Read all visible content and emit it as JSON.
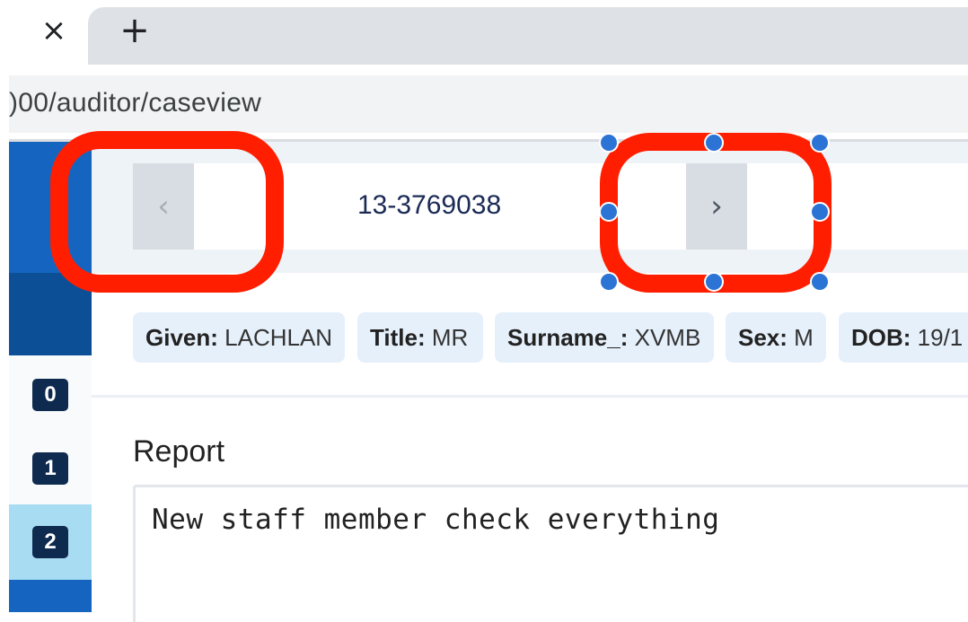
{
  "browser": {
    "close_tab_glyph": "×",
    "new_tab_glyph": "+",
    "url": ")00/auditor/caseview"
  },
  "sidebar": {
    "items": [
      {
        "label": "0"
      },
      {
        "label": "1"
      },
      {
        "label": "2"
      }
    ]
  },
  "case_nav": {
    "prev_glyph": "‹",
    "next_glyph": "›",
    "case_id": "13-3769038"
  },
  "patient": {
    "chips": [
      {
        "key": "Given:",
        "value": " LACHLAN"
      },
      {
        "key": "Title:",
        "value": " MR"
      },
      {
        "key": "Surname_:",
        "value": " XVMB"
      },
      {
        "key": "Sex:",
        "value": " M"
      },
      {
        "key": "DOB:",
        "value": " 19/1"
      }
    ]
  },
  "report": {
    "title": "Report",
    "text": "New staff member check everything"
  },
  "colors": {
    "annotation": "#ff1e00",
    "handle": "#2b74d6",
    "sidebar_primary": "#1565c0",
    "sidebar_highlight": "#a7dcf2"
  },
  "icons": {
    "close_tab": "close-icon",
    "new_tab": "plus-icon",
    "prev": "chevron-left-icon",
    "next": "chevron-right-icon"
  }
}
